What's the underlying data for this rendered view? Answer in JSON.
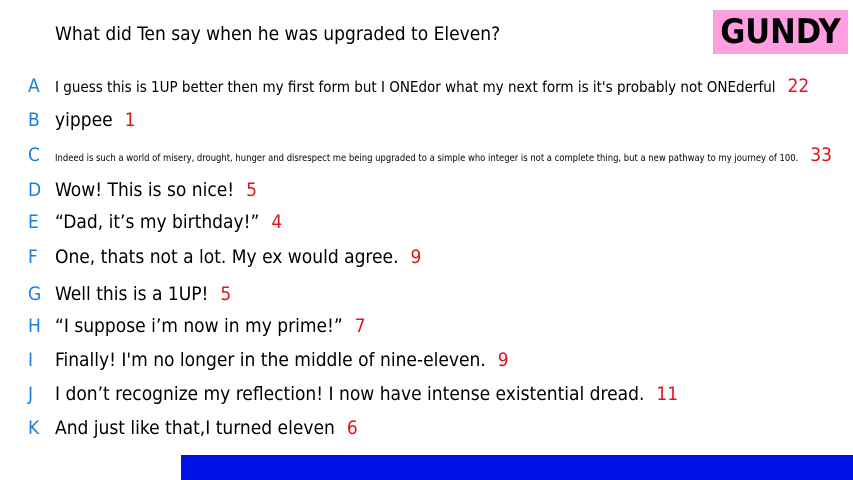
{
  "question": "What did Ten say when he was upgraded to Eleven?",
  "logo": "GUNDY",
  "answers": [
    {
      "letter": "A",
      "text": "I guess this is 1UP better then my first form but I ONEdor what my next form is it's probably not ONEderful",
      "score": "22"
    },
    {
      "letter": "B",
      "text": "yippee",
      "score": "1"
    },
    {
      "letter": "C",
      "text": "Indeed is such a world of misery, drought, hunger and disrespect me being upgraded to a simple who integer is not a complete thing, but a new pathway to my journey of 100.",
      "score": "33"
    },
    {
      "letter": "D",
      "text": "Wow! This is so nice!",
      "score": "5"
    },
    {
      "letter": "E",
      "text": "“Dad, it’s my birthday!”",
      "score": "4"
    },
    {
      "letter": "F",
      "text": "One, thats not a lot. My ex would agree.",
      "score": "9"
    },
    {
      "letter": "G",
      "text": "Well this is a 1UP!",
      "score": "5"
    },
    {
      "letter": "H",
      "text": "“I suppose i’m now in my prime!”",
      "score": "7"
    },
    {
      "letter": "I",
      "text": "Finally! I'm no longer in the middle of nine-eleven.",
      "score": "9"
    },
    {
      "letter": "J",
      "text": "I don’t recognize my reflection! I now have intense existential dread.",
      "score": "11"
    },
    {
      "letter": "K",
      "text": "And just like that,I turned eleven",
      "score": "6"
    }
  ],
  "colors": {
    "letter": "#1a7fe0",
    "score": "#e0131b",
    "logo_bg": "#ff9ee0",
    "bar": "#0011e6"
  }
}
